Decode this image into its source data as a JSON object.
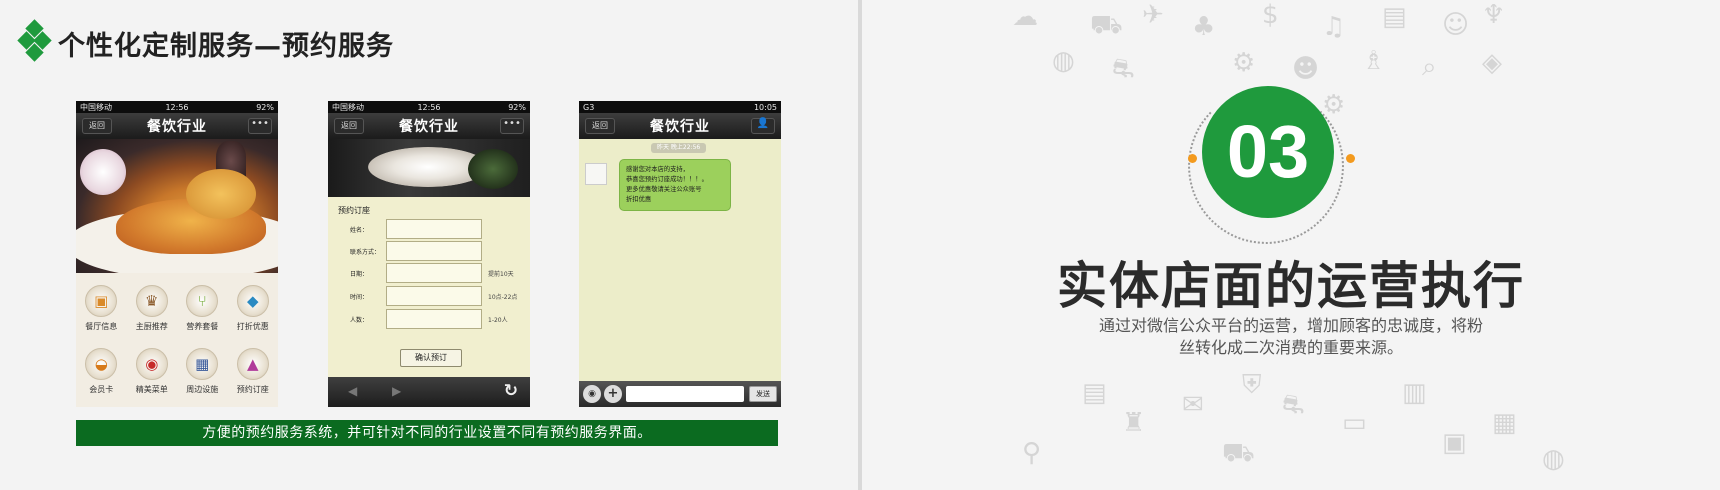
{
  "page": {
    "title": "个性化定制服务—预约服务",
    "caption": "方便的预约服务系统，并可针对不同的行业设置不同有预约服务界面。",
    "accent_color": "#1f9a3d",
    "caption_bg": "#0b6b20"
  },
  "phone1": {
    "status": {
      "carrier": "中国移动",
      "time": "12:56",
      "battery": "92%"
    },
    "nav": {
      "back": "返回",
      "title": "餐饮行业",
      "more": "•••"
    },
    "menu": [
      {
        "label": "餐厅信息",
        "icon": "restaurant-info-icon",
        "glyph": "▣"
      },
      {
        "label": "主厨推荐",
        "icon": "chef-hat-icon",
        "glyph": "♛"
      },
      {
        "label": "营养套餐",
        "icon": "cutlery-icon",
        "glyph": "⑂"
      },
      {
        "label": "打折优惠",
        "icon": "fish-icon",
        "glyph": "◆"
      },
      {
        "label": "会员卡",
        "icon": "roast-chicken-icon",
        "glyph": "◒"
      },
      {
        "label": "精美菜单",
        "icon": "target-menu-icon",
        "glyph": "◉"
      },
      {
        "label": "周边设施",
        "icon": "grid-facilities-icon",
        "glyph": "▦"
      },
      {
        "label": "预约订座",
        "icon": "cloche-icon",
        "glyph": "▲"
      }
    ]
  },
  "phone2": {
    "status": {
      "carrier": "中国移动",
      "time": "12:56",
      "battery": "92%"
    },
    "nav": {
      "back": "返回",
      "title": "餐饮行业",
      "more": "•••"
    },
    "form_title": "预约订座",
    "fields": [
      {
        "label": "姓名：",
        "hint": ""
      },
      {
        "label": "联系方式：",
        "hint": ""
      },
      {
        "label": "日期：",
        "hint": "提前10天"
      },
      {
        "label": "时间：",
        "hint": "10点-22点"
      },
      {
        "label": "人数：",
        "hint": "1-20人"
      }
    ],
    "confirm": "确认预订",
    "toolbar": {
      "prev": "◀",
      "next": "▶",
      "refresh": "↻"
    }
  },
  "phone3": {
    "status": {
      "left": "G3",
      "time": "10:05"
    },
    "nav": {
      "back": "返回",
      "title": "餐饮行业",
      "profile": "👤"
    },
    "chat_time": "昨天 晚上22:56",
    "message_lines": [
      "感谢您对本店的支持，",
      "恭喜您预约订座成功！！！。",
      "更多优惠敬请关注公众账号",
      "折扣优惠"
    ],
    "input": {
      "voice": "◉",
      "plus": "+",
      "send": "发送"
    }
  },
  "section": {
    "number": "03",
    "heading": "实体店面的运营执行",
    "desc_line1": "通过对微信公众平台的运营，增加顾客的忠诚度，将粉",
    "desc_line2": "丝转化成二次消费的重要来源。",
    "dot_color": "#f39a1e"
  }
}
